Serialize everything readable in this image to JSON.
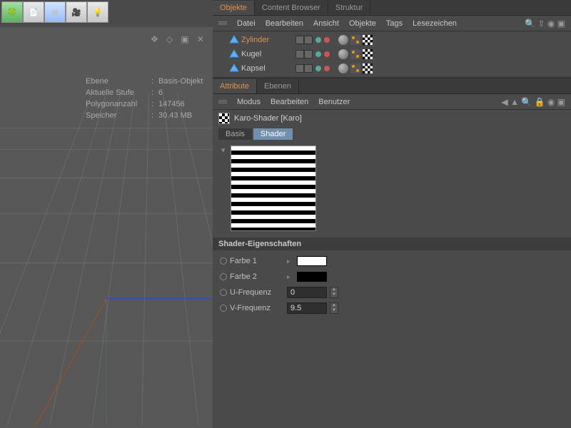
{
  "toolbar": {
    "icons": [
      "clover",
      "paper",
      "grid-blue",
      "camera",
      "bulb"
    ]
  },
  "viewport": {
    "hud_icons": "✥ ◇ ▣ ✕",
    "info": {
      "level_label": "Ebene",
      "level_value": "Basis-Objekt",
      "stage_label": "Aktuelle Stufe",
      "stage_value": "6",
      "polycount_label": "Polygonanzahl",
      "polycount_value": "147456",
      "memory_label": "Speicher",
      "memory_value": "30.43 MB"
    }
  },
  "objects_panel": {
    "tabs": [
      "Objekte",
      "Content Browser",
      "Struktur"
    ],
    "active_tab": 0,
    "menu": [
      "Datei",
      "Bearbeiten",
      "Ansicht",
      "Objekte",
      "Tags",
      "Lesezeichen"
    ],
    "items": [
      {
        "name": "Zylinder",
        "selected": true
      },
      {
        "name": "Kugel",
        "selected": false
      },
      {
        "name": "Kapsel",
        "selected": false
      }
    ]
  },
  "attr_panel": {
    "tabs": [
      "Attribute",
      "Ebenen"
    ],
    "active_tab": 0,
    "menu": [
      "Modus",
      "Bearbeiten",
      "Benutzer"
    ],
    "title": "Karo-Shader [Karo]",
    "sub_tabs": [
      "Basis",
      "Shader"
    ],
    "active_sub_tab": 1,
    "section_title": "Shader-Eigenschaften",
    "props": {
      "color1_label": "Farbe 1",
      "color1_value": "#ffffff",
      "color2_label": "Farbe 2",
      "color2_value": "#000000",
      "ufreq_label": "U-Frequenz",
      "ufreq_value": "0",
      "vfreq_label": "V-Frequenz",
      "vfreq_value": "9.5"
    }
  }
}
